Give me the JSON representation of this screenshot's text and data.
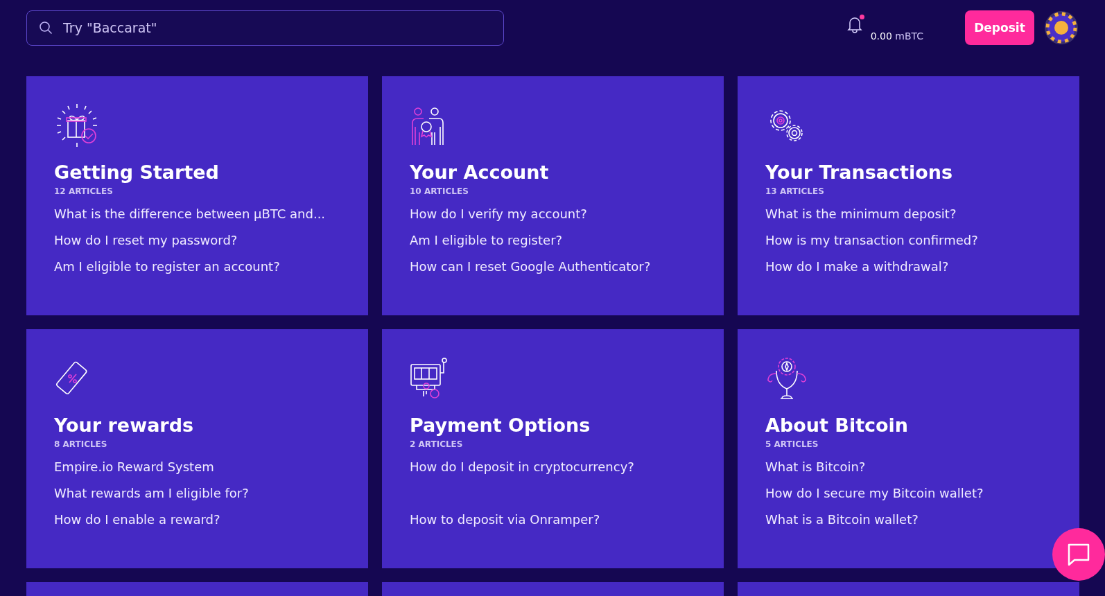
{
  "search": {
    "placeholder": "Try \"Baccarat\""
  },
  "header": {
    "notification_unread": true,
    "balance_amount": "0.00",
    "balance_unit": "mBTC",
    "deposit_label": "Deposit"
  },
  "categories": [
    {
      "kind": "gift",
      "title": "Getting Started",
      "count": "12 ARTICLES",
      "links": [
        "What is the difference between µBTC and...",
        "How do I reset my password?",
        "Am I eligible to register an account?"
      ]
    },
    {
      "kind": "people",
      "title": "Your Account",
      "count": "10 ARTICLES",
      "links": [
        "How do I verify my account?",
        "Am I eligible to register?",
        "How can I reset Google Authenticator?"
      ]
    },
    {
      "kind": "gears",
      "title": "Your Transactions",
      "count": "13 ARTICLES",
      "links": [
        "What is the minimum deposit?",
        "How is my transaction confirmed?",
        "How do I make a withdrawal?"
      ]
    },
    {
      "kind": "coupon",
      "title": "Your rewards",
      "count": "8 ARTICLES",
      "links": [
        "Empire.io Reward System",
        "What rewards am I eligible for?",
        "How do I enable a reward?"
      ]
    },
    {
      "kind": "slot",
      "title": "Payment Options",
      "count": "2 ARTICLES",
      "links": [
        "How do I deposit in cryptocurrency?",
        "How to deposit via Onramper?"
      ]
    },
    {
      "kind": "trophy",
      "title": "About Bitcoin",
      "count": "5 ARTICLES",
      "links": [
        "What is Bitcoin?",
        "How do I secure my Bitcoin wallet?",
        "What is a Bitcoin wallet?"
      ]
    }
  ]
}
